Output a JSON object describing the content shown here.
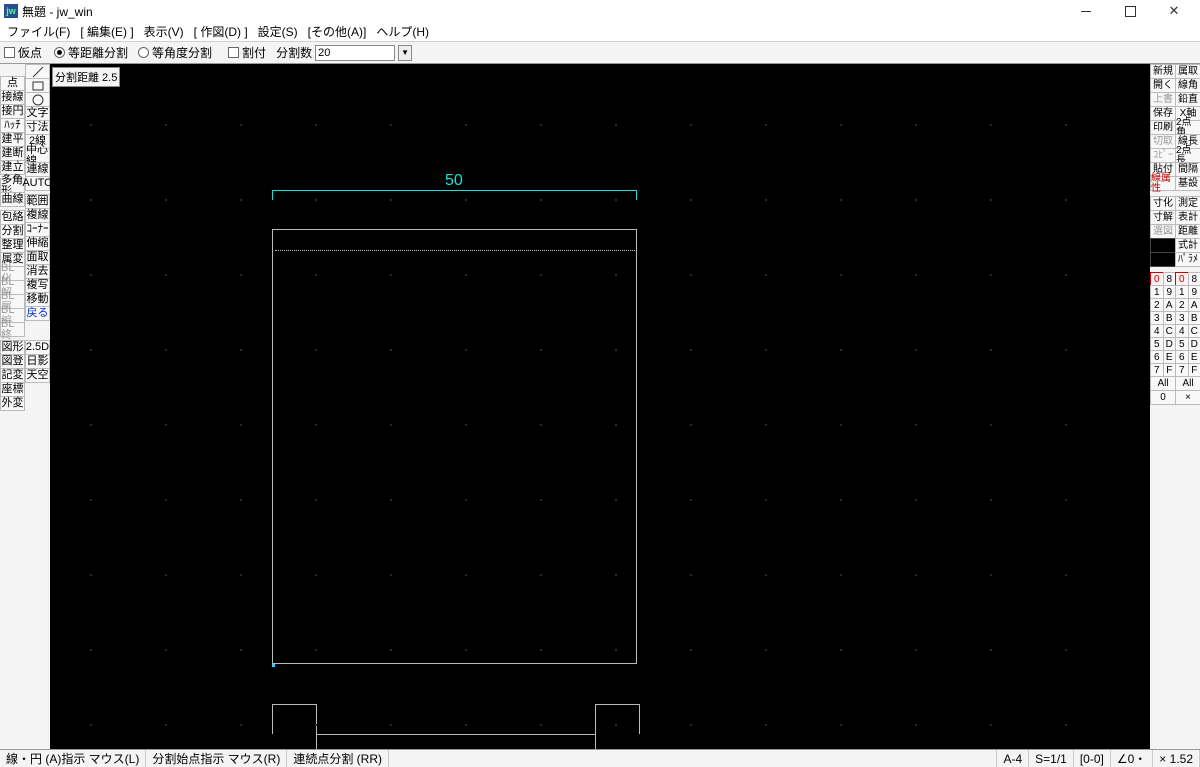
{
  "title": "無題 - jw_win",
  "menu": [
    "ファイル(F)",
    "[ 編集(E) ]",
    "表示(V)",
    "[ 作図(D) ]",
    "設定(S)",
    "[その他(A)]",
    "ヘルプ(H)"
  ],
  "controlbar": {
    "kari": "仮点",
    "eq_dist": "等距離分割",
    "eq_ang": "等角度分割",
    "waritsuke": "割付",
    "bunkatsu_label": "分割数",
    "bunkatsu_value": "20"
  },
  "canvas": {
    "hint": "分割距離    2.5",
    "dim": "50"
  },
  "left_tools_a": [
    {
      "t": "/",
      "svg": true
    },
    {
      "t": "□",
      "svg": "rect"
    },
    {
      "t": "○",
      "svg": "circ"
    },
    {
      "t": "文字"
    },
    {
      "t": "寸法"
    },
    {
      "t": "2線"
    },
    {
      "t": "中心線"
    },
    {
      "t": "連線"
    },
    {
      "t": "AUTO"
    },
    {
      "sp": true
    },
    {
      "t": "範囲"
    },
    {
      "t": "複線"
    },
    {
      "t": "ｺｰﾅｰ"
    },
    {
      "t": "伸縮"
    },
    {
      "t": "面取"
    },
    {
      "t": "消去"
    },
    {
      "t": "複写"
    },
    {
      "t": "移動"
    },
    {
      "t": "戻る",
      "blue": true
    },
    {
      "sp": true
    },
    {
      "sp": true
    },
    {
      "sp": true
    },
    {
      "sp": true
    },
    {
      "sp": true
    },
    {
      "t": "2.5D"
    },
    {
      "t": "日影"
    },
    {
      "t": "天空"
    }
  ],
  "left_tools_b": [
    {
      "sp": true
    },
    {
      "sp": true
    },
    {
      "sp": true
    },
    {
      "t": "点"
    },
    {
      "t": "接線"
    },
    {
      "t": "接円"
    },
    {
      "t": "ﾊｯﾁ"
    },
    {
      "t": "建平"
    },
    {
      "t": "建断"
    },
    {
      "t": "建立"
    },
    {
      "sp": true
    },
    {
      "t": "多角形"
    },
    {
      "t": "曲線"
    },
    {
      "sp": true
    },
    {
      "t": "包絡"
    },
    {
      "t": "分割"
    },
    {
      "t": "整理"
    },
    {
      "t": "属変"
    },
    {
      "t": "BL化",
      "dis": true
    },
    {
      "t": "BL解",
      "dis": true
    },
    {
      "t": "BL属",
      "dis": true
    },
    {
      "t": "BL編",
      "dis": true
    },
    {
      "t": "BL終",
      "dis": true
    },
    {
      "sp": true
    },
    {
      "t": "図形"
    },
    {
      "t": "図登"
    },
    {
      "t": "記変"
    },
    {
      "t": "座標"
    },
    {
      "t": "外変"
    }
  ],
  "right_tools": [
    [
      "新規",
      "属取"
    ],
    [
      "開く",
      "線角"
    ],
    [
      "上書",
      "鉛直"
    ],
    [
      "保存",
      "X軸"
    ],
    [
      "印刷",
      "2点角"
    ],
    [
      "切取",
      "線長"
    ],
    [
      "ｺﾋﾟｰ",
      "2点長"
    ],
    [
      "貼付",
      "間隔"
    ],
    [
      "線属性",
      "基設"
    ],
    [],
    [
      "寸化",
      "測定"
    ],
    [
      "寸解",
      "表計"
    ],
    [
      "選図",
      "距離"
    ],
    [
      "",
      "式計"
    ],
    [
      "",
      "ﾊﾟﾗﾒ"
    ]
  ],
  "right_disabled": [
    "上書",
    "切取",
    "ｺﾋﾟｰ",
    "選図"
  ],
  "right_red": [
    "線属性"
  ],
  "layers": {
    "rows": [
      [
        "0",
        "8",
        "0",
        "8"
      ],
      [
        "1",
        "9",
        "1",
        "9"
      ],
      [
        "2",
        "A",
        "2",
        "A"
      ],
      [
        "3",
        "B",
        "3",
        "B"
      ],
      [
        "4",
        "C",
        "4",
        "C"
      ],
      [
        "5",
        "D",
        "5",
        "D"
      ],
      [
        "6",
        "E",
        "6",
        "E"
      ],
      [
        "7",
        "F",
        "7",
        "F"
      ]
    ],
    "all": [
      "All",
      "All"
    ],
    "zero": [
      "0",
      "×"
    ]
  },
  "status": {
    "left1": "線・円 (A)指示   マウス(L)",
    "left2": "分割始点指示   マウス(R)",
    "left3": "連続点分割 (RR)",
    "s1": "A-4",
    "s2": "S=1/1",
    "s3": "[0-0]",
    "s4": "∠0・",
    "s5": "× 1.52"
  }
}
